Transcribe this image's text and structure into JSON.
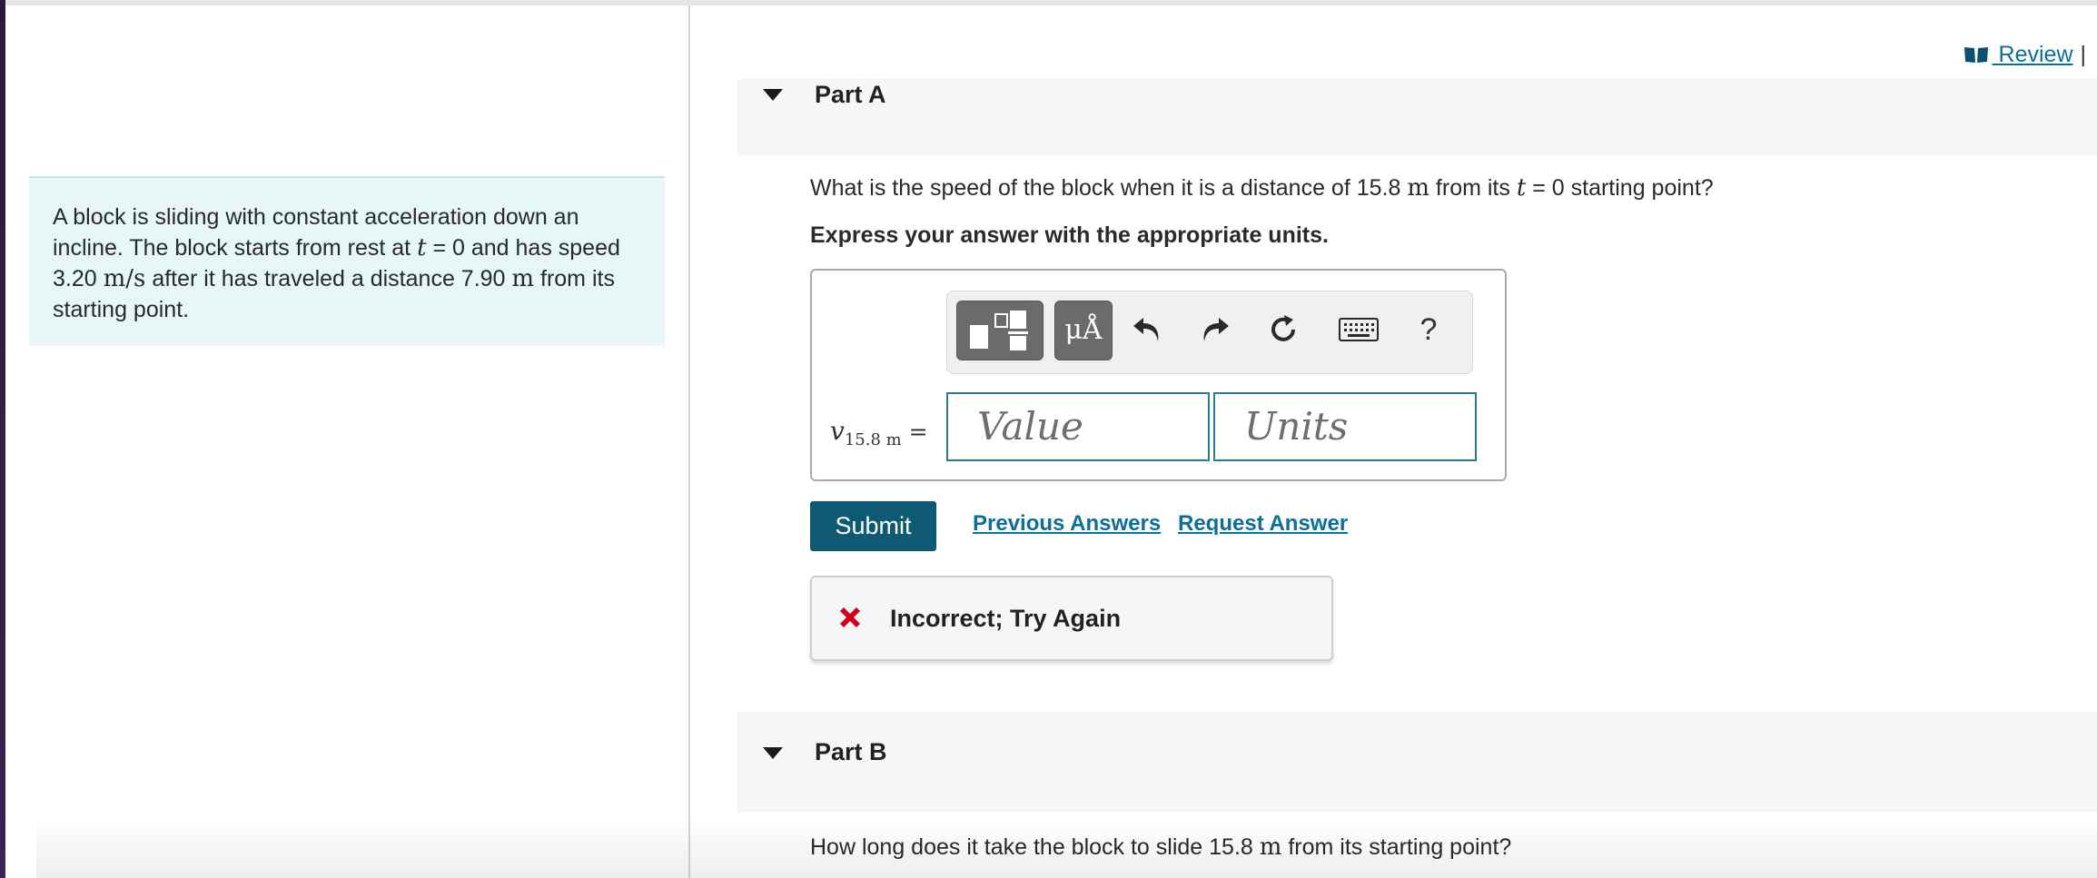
{
  "intro": {
    "text_1": "A block is sliding with constant acceleration down an incline. The block starts from rest at ",
    "t_var": "t",
    "text_2": " = 0 and has speed 3.20 ",
    "speed_unit": "m/s",
    "text_3": " after it has traveled a distance 7.90 ",
    "dist_unit": "m",
    "text_4": " from its starting point."
  },
  "review": {
    "label": " Review",
    "separator": "|"
  },
  "part_a": {
    "title": "Part A",
    "question_1": "What is the speed of the block when it is a distance of 15.8 ",
    "question_unit": "m",
    "question_2": " from its ",
    "question_t": "t",
    "question_3": " = 0 starting point?",
    "instruction": "Express your answer with the appropriate units.",
    "toolbar": {
      "units_label": "μÅ",
      "help_label": "?",
      "icons": [
        "templates-icon",
        "units-icon",
        "undo-icon",
        "redo-icon",
        "reset-icon",
        "keyboard-icon",
        "help-icon"
      ]
    },
    "variable": "v",
    "variable_sub": "15.8 m",
    "equals": " =",
    "value_placeholder": "Value",
    "units_placeholder": "Units",
    "submit_label": "Submit",
    "previous_answers_label": "Previous Answers",
    "request_answer_label": "Request Answer",
    "feedback": "Incorrect; Try Again"
  },
  "part_b": {
    "title": "Part B",
    "question_1": "How long does it take the block to slide 15.8 ",
    "question_unit": "m",
    "question_2": " from its starting point?"
  },
  "colors": {
    "accent": "#0d5a72",
    "link": "#0b6f9c",
    "intro_bg": "#e7f6f6",
    "error": "#d0021b",
    "field_border": "#2b7a91"
  }
}
